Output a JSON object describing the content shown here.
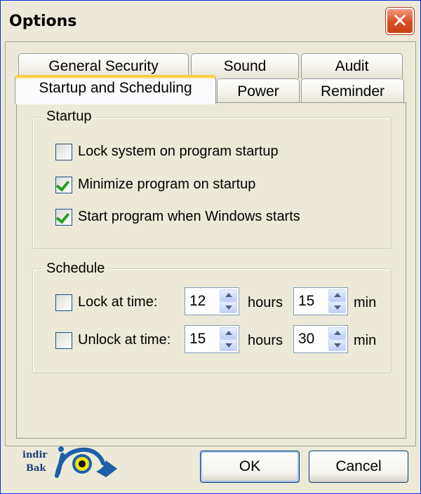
{
  "window": {
    "title": "Options",
    "close_glyph": "✕"
  },
  "tabs": {
    "row1": [
      "General Security",
      "Sound",
      "Audit"
    ],
    "row2": [
      "Startup and Scheduling",
      "Power",
      "Reminder"
    ],
    "active": "Startup and Scheduling"
  },
  "startup": {
    "group_label": "Startup",
    "options": [
      {
        "label": "Lock system on program startup",
        "checked": false
      },
      {
        "label": "Minimize program on startup",
        "checked": true
      },
      {
        "label": "Start program when Windows starts",
        "checked": true
      }
    ]
  },
  "schedule": {
    "group_label": "Schedule",
    "lock": {
      "label": "Lock at time:",
      "checked": false,
      "hours": "12",
      "minutes": "15"
    },
    "unlock": {
      "label": "Unlock at time:",
      "checked": false,
      "hours": "15",
      "minutes": "30"
    },
    "hours_unit": "hours",
    "min_unit": "min"
  },
  "buttons": {
    "ok": "OK",
    "cancel": "Cancel"
  },
  "logo": {
    "line1": "indir",
    "line2": "Bak"
  },
  "colors": {
    "accent": "#FFC83C",
    "check": "#21A121",
    "close": "#D94C22",
    "face": "#ECE9D8"
  }
}
